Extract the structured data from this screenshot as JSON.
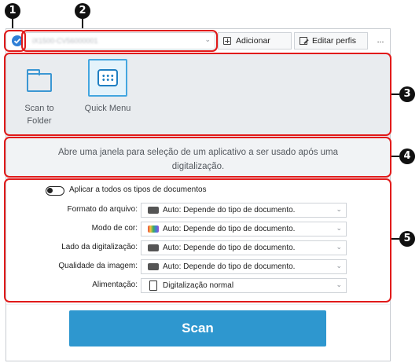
{
  "callouts": [
    "1",
    "2",
    "3",
    "4",
    "5"
  ],
  "toolbar": {
    "profile_name": "iX1500-CV56000001",
    "add_profile_label": "Adicionar perfis",
    "edit_profile_label": "Editar perfis",
    "more_label": "..."
  },
  "apps": [
    {
      "label": "Scan to\nFolder",
      "icon": "folder-icon"
    },
    {
      "label": "Quick Menu",
      "icon": "quick-menu-icon"
    }
  ],
  "description": "Abre uma janela para seleção de um aplicativo a ser usado após uma digitalização.",
  "settings": {
    "apply_all_label": "Aplicar a todos os tipos de documentos",
    "rows": [
      {
        "label": "Formato do arquivo:",
        "value": "Auto: Depende do tipo de documento.",
        "icon": "auto-file-icon"
      },
      {
        "label": "Modo de cor:",
        "value": "Auto: Depende do tipo de documento.",
        "icon": "auto-color-icon"
      },
      {
        "label": "Lado da digitalização:",
        "value": "Auto: Depende do tipo de documento.",
        "icon": "auto-side-icon"
      },
      {
        "label": "Qualidade da imagem:",
        "value": "Auto: Depende do tipo de documento.",
        "icon": "auto-quality-icon"
      },
      {
        "label": "Alimentação:",
        "value": "Digitalização normal",
        "icon": "document-icon"
      }
    ]
  },
  "scan_label": "Scan",
  "colors": {
    "accent": "#2e97cf",
    "callout_border": "#e11a1a"
  }
}
